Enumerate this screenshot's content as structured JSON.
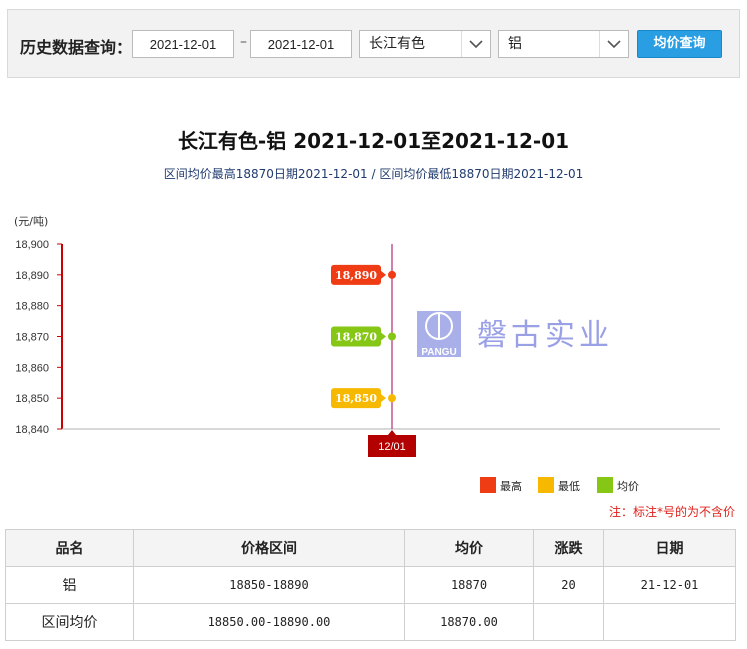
{
  "query": {
    "label": "历史数据查询：",
    "date_start": "2021-12-01",
    "separator": "–",
    "date_end": "2021-12-01",
    "market": "长江有色",
    "product": "铝",
    "button": "均价查询"
  },
  "chart_data": {
    "type": "line",
    "title": "长江有色-铝 2021-12-01至2021-12-01",
    "subtitle": "区间均价最高18870日期2021-12-01 / 区间均价最低18870日期2021-12-01",
    "ylabel": "(元/吨)",
    "ylim": [
      18840,
      18900
    ],
    "yticks": [
      "18,900",
      "18,890",
      "18,880",
      "18,870",
      "18,860",
      "18,850",
      "18,840"
    ],
    "ytick_values": [
      18900,
      18890,
      18880,
      18870,
      18860,
      18850,
      18840
    ],
    "categories": [
      "12/01"
    ],
    "series": [
      {
        "name": "最高",
        "values": [
          18890
        ],
        "labels": [
          "18,890"
        ],
        "color": "#f03c14"
      },
      {
        "name": "最低",
        "values": [
          18850
        ],
        "labels": [
          "18,850"
        ],
        "color": "#f7b800"
      },
      {
        "name": "均价",
        "values": [
          18870
        ],
        "labels": [
          "18,870"
        ],
        "color": "#86c614"
      }
    ],
    "legend_position": "bottom-right",
    "watermark": "PANGU 磐古实业",
    "axis_color": "#cc0000",
    "category_label_color": "#b30000"
  },
  "note": "注：标注*号的为不含价",
  "table": {
    "headers": [
      "品名",
      "价格区间",
      "均价",
      "涨跌",
      "日期"
    ],
    "rows": [
      [
        "铝",
        "18850-18890",
        "18870",
        "20",
        "21-12-01"
      ],
      [
        "区间均价",
        "18850.00-18890.00",
        "18870.00",
        "",
        ""
      ]
    ]
  }
}
